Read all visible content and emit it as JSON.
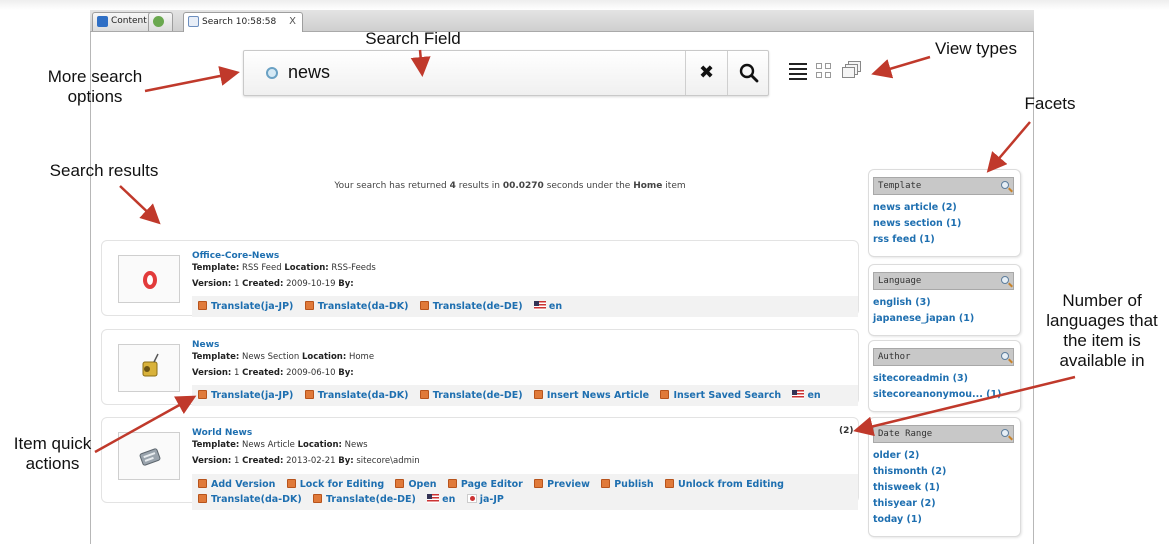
{
  "tabs": [
    {
      "label": "Content"
    },
    {
      "label": ""
    },
    {
      "label": "Search 10:58:58",
      "close": "X"
    }
  ],
  "search": {
    "query": "news",
    "clear_icon": "close-icon",
    "search_icon": "search-icon",
    "options_icon": "caret-down-icon"
  },
  "view_types": [
    "list-view-icon",
    "grid-view-icon",
    "charts-view-icon"
  ],
  "annotations": {
    "search_field": "Search Field",
    "more_search_options": "More search\noptions",
    "view_types": "View types",
    "facets": "Facets",
    "search_results": "Search results",
    "number_of_languages": "Number of\nlanguages that\nthe item is\navailable in",
    "item_quick_actions": "Item quick\nactions"
  },
  "summary": {
    "prefix": "Your search has returned",
    "count": "4",
    "middle": "results in",
    "time": "00.0270",
    "suffix": "seconds under the",
    "root": "Home",
    "end": "item"
  },
  "results": [
    {
      "title": "Office-Core-News",
      "template_label": "Template:",
      "template": "RSS Feed",
      "location_label": "Location:",
      "location": "RSS-Feeds",
      "version_label": "Version:",
      "version": "1",
      "created_label": "Created:",
      "created": "2009-10-19",
      "by_label": "By:",
      "by": "",
      "actions": [
        "Translate(ja-JP)",
        "Translate(da-DK)",
        "Translate(de-DE)"
      ],
      "languages": [
        "en"
      ]
    },
    {
      "title": "News",
      "template_label": "Template:",
      "template": "News Section",
      "location_label": "Location:",
      "location": "Home",
      "version_label": "Version:",
      "version": "1",
      "created_label": "Created:",
      "created": "2009-06-10",
      "by_label": "By:",
      "by": "",
      "actions": [
        "Translate(ja-JP)",
        "Translate(da-DK)",
        "Translate(de-DE)",
        "Insert News Article",
        "Insert Saved Search"
      ],
      "languages": [
        "en"
      ]
    },
    {
      "title": "World News",
      "template_label": "Template:",
      "template": "News Article",
      "location_label": "Location:",
      "location": "News",
      "version_label": "Version:",
      "version": "1",
      "created_label": "Created:",
      "created": "2013-02-21",
      "by_label": "By:",
      "by": "sitecore\\admin",
      "language_count": "(2)",
      "actions": [
        "Add Version",
        "Lock for Editing",
        "Open",
        "Page Editor",
        "Preview",
        "Publish",
        "Unlock from Editing",
        "Translate(da-DK)",
        "Translate(de-DE)"
      ],
      "languages": [
        "en",
        "ja-JP"
      ]
    }
  ],
  "facets": [
    {
      "name": "Template",
      "items": [
        "news article (2)",
        "news section (1)",
        "rss feed (1)"
      ]
    },
    {
      "name": "Language",
      "items": [
        "english (3)",
        "japanese_japan (1)"
      ]
    },
    {
      "name": "Author",
      "items": [
        "sitecoreadmin (3)",
        "sitecoreanonymou... (1)"
      ]
    },
    {
      "name": "Date Range",
      "items": [
        "older (2)",
        "thismonth (2)",
        "thisweek (1)",
        "thisyear (2)",
        "today (1)"
      ]
    }
  ],
  "colors": {
    "link": "#1e6fb0",
    "arrow": "#c0392b",
    "facet_header": "#c8c8c8"
  }
}
